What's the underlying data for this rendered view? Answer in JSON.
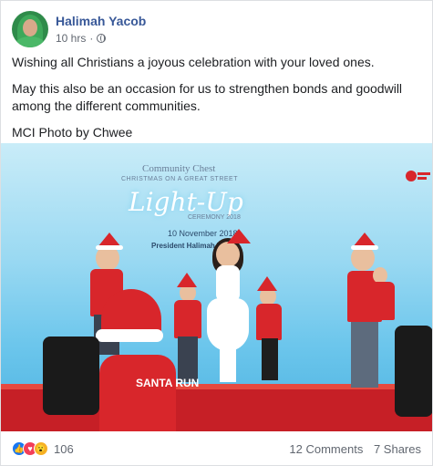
{
  "post": {
    "author": "Halimah Yacob",
    "time": "10 hrs",
    "privacy_icon": "globe-icon",
    "paragraphs": [
      "Wishing all Christians a joyous celebration with your loved ones.",
      "May this also be an occasion for us to strengthen bonds and goodwill among the different communities.",
      "MCI Photo by Chwee"
    ]
  },
  "photo": {
    "banner_title": "Community Chest",
    "banner_sub": "CHRISTMAS ON A GREAT STREET",
    "banner_script": "Light-Up",
    "banner_cer": "CEREMONY 2018",
    "banner_date": "10 November 2018",
    "banner_pres": "President Halimah Yacob",
    "shirt_text": "SANTA RUN"
  },
  "footer": {
    "reactions": [
      "like",
      "love",
      "wow"
    ],
    "reaction_count": "106",
    "comments": "12 Comments",
    "shares": "7 Shares"
  },
  "colors": {
    "name": "#385898",
    "like": "#1877f2",
    "love": "#f33e58",
    "wow": "#f7b125",
    "stage": "#c61f26"
  }
}
